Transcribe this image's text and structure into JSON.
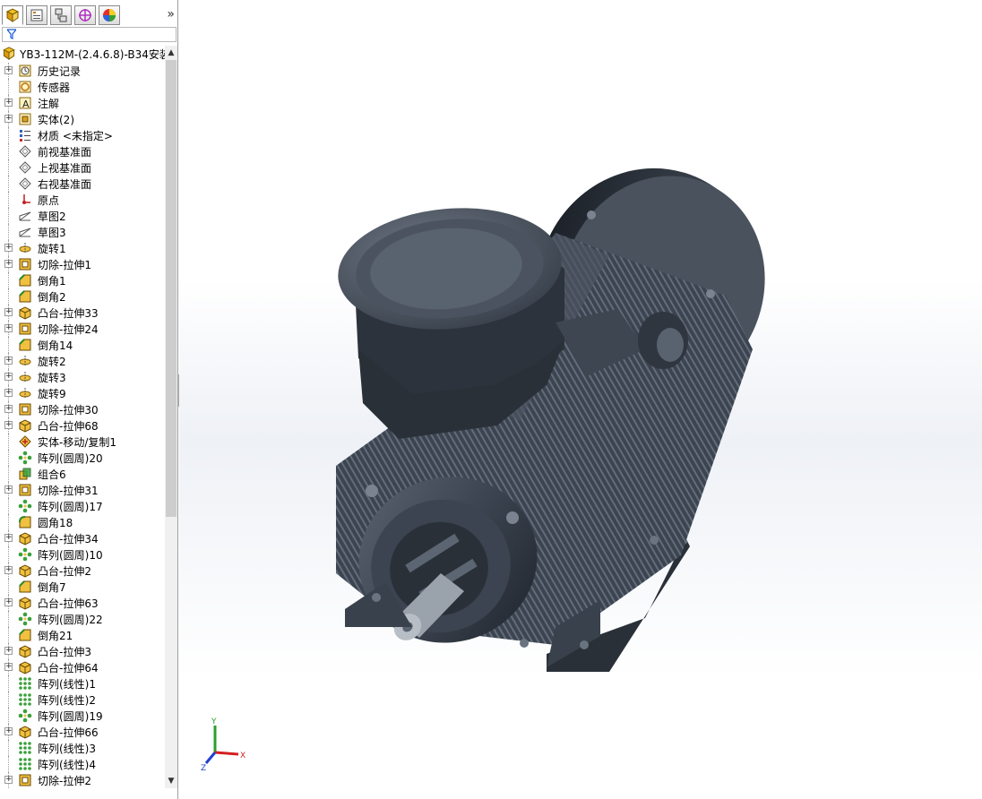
{
  "tabs": [
    {
      "name": "feature-manager",
      "active": true
    },
    {
      "name": "property-manager",
      "active": false
    },
    {
      "name": "configuration-manager",
      "active": false
    },
    {
      "name": "dimxpert-manager",
      "active": false
    },
    {
      "name": "display-manager",
      "active": false
    }
  ],
  "tabs_more": "»",
  "tree": {
    "root_label": "YB3-112M-(2.4.6.8)-B34安装",
    "items": [
      {
        "label": "历史记录",
        "icon": "history-icon",
        "expand": true
      },
      {
        "label": "传感器",
        "icon": "sensor-icon",
        "expand": false
      },
      {
        "label": "注解",
        "icon": "annotation-icon",
        "expand": true
      },
      {
        "label": "实体(2)",
        "icon": "solid-bodies-icon",
        "expand": true
      },
      {
        "label": "材质 <未指定>",
        "icon": "material-icon",
        "expand": false
      },
      {
        "label": "前视基准面",
        "icon": "plane-icon",
        "expand": false
      },
      {
        "label": "上视基准面",
        "icon": "plane-icon",
        "expand": false
      },
      {
        "label": "右视基准面",
        "icon": "plane-icon",
        "expand": false
      },
      {
        "label": "原点",
        "icon": "origin-icon",
        "expand": false
      },
      {
        "label": "草图2",
        "icon": "sketch-icon",
        "expand": false
      },
      {
        "label": "草图3",
        "icon": "sketch-icon",
        "expand": false
      },
      {
        "label": "旋转1",
        "icon": "revolve-icon",
        "expand": true
      },
      {
        "label": "切除-拉伸1",
        "icon": "cut-extrude-icon",
        "expand": true
      },
      {
        "label": "倒角1",
        "icon": "chamfer-icon",
        "expand": false
      },
      {
        "label": "倒角2",
        "icon": "chamfer-icon",
        "expand": false
      },
      {
        "label": "凸台-拉伸33",
        "icon": "boss-extrude-icon",
        "expand": true
      },
      {
        "label": "切除-拉伸24",
        "icon": "cut-extrude-icon",
        "expand": true
      },
      {
        "label": "倒角14",
        "icon": "chamfer-icon",
        "expand": false
      },
      {
        "label": "旋转2",
        "icon": "revolve-icon",
        "expand": true
      },
      {
        "label": "旋转3",
        "icon": "revolve-icon",
        "expand": true
      },
      {
        "label": "旋转9",
        "icon": "revolve-icon",
        "expand": true
      },
      {
        "label": "切除-拉伸30",
        "icon": "cut-extrude-icon",
        "expand": true
      },
      {
        "label": "凸台-拉伸68",
        "icon": "boss-extrude-icon",
        "expand": true
      },
      {
        "label": "实体-移动/复制1",
        "icon": "move-copy-icon",
        "expand": false
      },
      {
        "label": "阵列(圆周)20",
        "icon": "circular-pattern-icon",
        "expand": false
      },
      {
        "label": "组合6",
        "icon": "combine-icon",
        "expand": false
      },
      {
        "label": "切除-拉伸31",
        "icon": "cut-extrude-icon",
        "expand": true
      },
      {
        "label": "阵列(圆周)17",
        "icon": "circular-pattern-icon",
        "expand": false
      },
      {
        "label": "圆角18",
        "icon": "fillet-icon",
        "expand": false
      },
      {
        "label": "凸台-拉伸34",
        "icon": "boss-extrude-icon",
        "expand": true
      },
      {
        "label": "阵列(圆周)10",
        "icon": "circular-pattern-icon",
        "expand": false
      },
      {
        "label": "凸台-拉伸2",
        "icon": "boss-extrude-icon",
        "expand": true
      },
      {
        "label": "倒角7",
        "icon": "chamfer-icon",
        "expand": false
      },
      {
        "label": "凸台-拉伸63",
        "icon": "boss-extrude-icon",
        "expand": true
      },
      {
        "label": "阵列(圆周)22",
        "icon": "circular-pattern-icon",
        "expand": false
      },
      {
        "label": "倒角21",
        "icon": "chamfer-icon",
        "expand": false
      },
      {
        "label": "凸台-拉伸3",
        "icon": "boss-extrude-icon",
        "expand": true
      },
      {
        "label": "凸台-拉伸64",
        "icon": "boss-extrude-icon",
        "expand": true
      },
      {
        "label": "阵列(线性)1",
        "icon": "linear-pattern-icon",
        "expand": false
      },
      {
        "label": "阵列(线性)2",
        "icon": "linear-pattern-icon",
        "expand": false
      },
      {
        "label": "阵列(圆周)19",
        "icon": "circular-pattern-icon",
        "expand": false
      },
      {
        "label": "凸台-拉伸66",
        "icon": "boss-extrude-icon",
        "expand": true
      },
      {
        "label": "阵列(线性)3",
        "icon": "linear-pattern-icon",
        "expand": false
      },
      {
        "label": "阵列(线性)4",
        "icon": "linear-pattern-icon",
        "expand": false
      },
      {
        "label": "切除-拉伸2",
        "icon": "cut-extrude-icon",
        "expand": true
      }
    ]
  },
  "triad": {
    "x": "X",
    "y": "Y",
    "z": "Z"
  },
  "colors": {
    "body": "#3a4350",
    "body_light": "#59626f",
    "body_dark": "#20252d",
    "highlight": "#7a838f",
    "triad_x": "#d42020",
    "triad_y": "#2aa02a",
    "triad_z": "#2040d0"
  }
}
